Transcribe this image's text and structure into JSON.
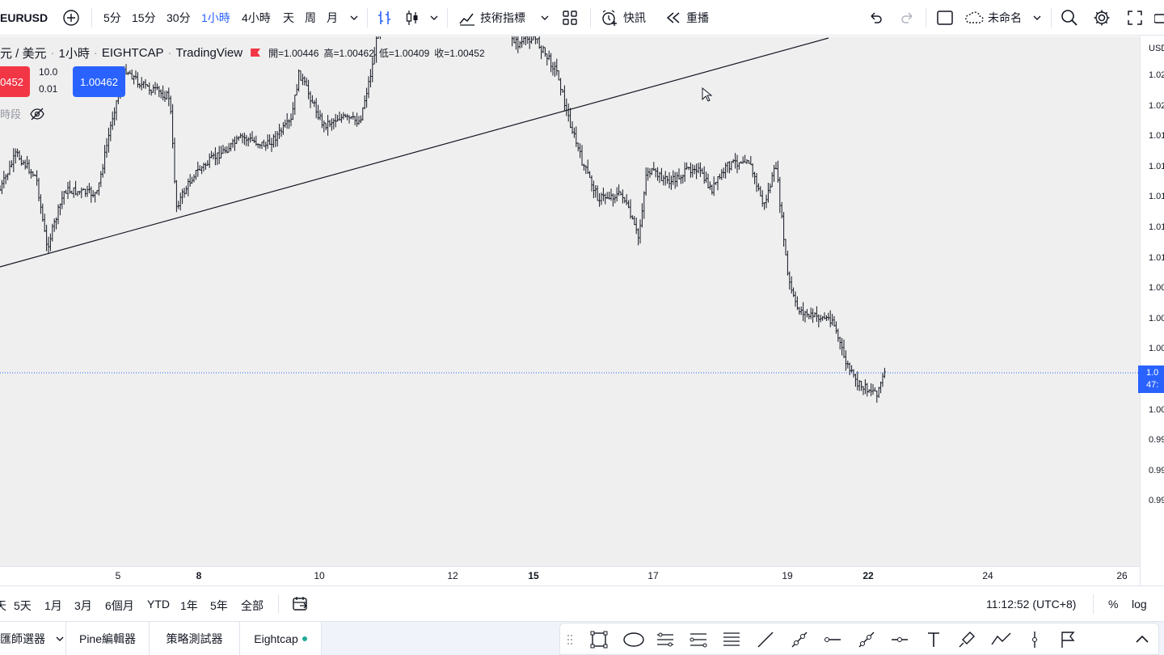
{
  "toolbar": {
    "symbol": "EURUSD",
    "intervals": [
      "5分",
      "15分",
      "30分",
      "1小時",
      "4小時",
      "天",
      "周",
      "月"
    ],
    "active_interval": "1小時",
    "indicators_label": "技術指標",
    "alert_label": "快訊",
    "replay_label": "重播",
    "layout_name": "未命名"
  },
  "legend": {
    "pair": "元 / 美元",
    "interval": "1小時",
    "exchange": "EIGHTCAP",
    "source": "TradingView",
    "open": "開=1.00446",
    "high": "高=1.00462",
    "low": "低=1.00409",
    "close": "收=1.00452",
    "sell_price": "0452",
    "qty_top": "10.0",
    "qty_bottom": "0.01",
    "buy_price": "1.00462",
    "session_label": "時段"
  },
  "axes": {
    "price_currency": "USD",
    "price_labels": [
      "1.02",
      "1.02",
      "1.01",
      "1.01",
      "1.01",
      "1.01",
      "1.01",
      "1.00",
      "1.00",
      "1.00",
      "1.00",
      "1.00",
      "0.99",
      "0.99",
      "0.99"
    ],
    "time_labels": [
      {
        "text": "5",
        "bold": false
      },
      {
        "text": "8",
        "bold": true
      },
      {
        "text": "10",
        "bold": false
      },
      {
        "text": "12",
        "bold": false
      },
      {
        "text": "15",
        "bold": true
      },
      {
        "text": "17",
        "bold": false
      },
      {
        "text": "19",
        "bold": false
      },
      {
        "text": "22",
        "bold": true
      },
      {
        "text": "24",
        "bold": false
      },
      {
        "text": "26",
        "bold": false
      }
    ],
    "current_price_tag_top": "1.0",
    "current_price_tag_bottom": "47:"
  },
  "rangebar": {
    "ranges": [
      "天",
      "5天",
      "1月",
      "3月",
      "6個月",
      "YTD",
      "1年",
      "5年",
      "全部"
    ],
    "clock": "11:12:52 (UTC+8)",
    "percent_label": "%",
    "log_label": "log"
  },
  "bottom_tabs": {
    "screener": "匯師選器",
    "pine": "Pine編輯器",
    "strategy": "策略測試器",
    "broker": "Eightcap"
  },
  "colors": {
    "accent": "#2962ff",
    "sell": "#f23645",
    "online": "#22ab94"
  }
}
